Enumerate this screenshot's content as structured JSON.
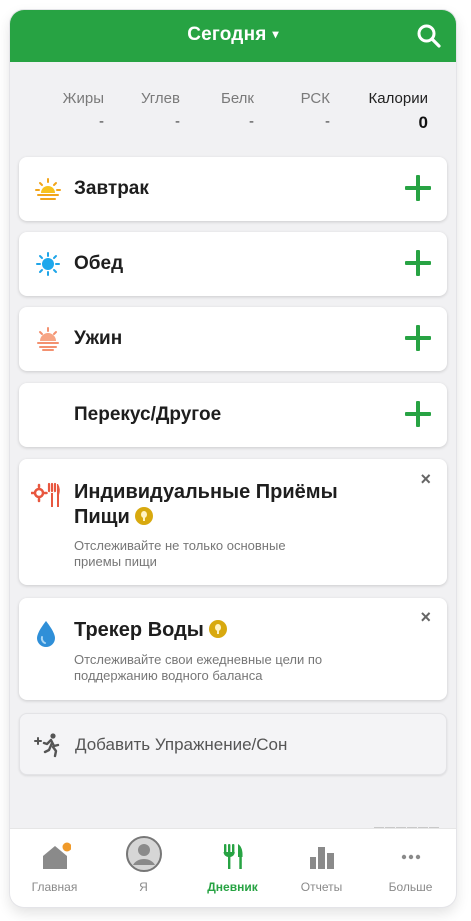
{
  "header": {
    "title": "Сегодня",
    "caret": "▾",
    "accent_color": "#27a343"
  },
  "summary": {
    "fat": {
      "label": "Жиры",
      "value": "-"
    },
    "carbs": {
      "label": "Углев",
      "value": "-"
    },
    "protein": {
      "label": "Белк",
      "value": "-"
    },
    "rsk": {
      "label": "РСК",
      "value": "-"
    },
    "calories": {
      "label": "Калории",
      "value": "0"
    }
  },
  "meals": [
    {
      "label": "Завтрак",
      "icon": "sunrise-icon"
    },
    {
      "label": "Обед",
      "icon": "sun-icon"
    },
    {
      "label": "Ужин",
      "icon": "sunset-icon"
    },
    {
      "label": "Перекус/Другое",
      "icon": "moon-icon"
    }
  ],
  "promos": [
    {
      "title_line1": "Индивидуальные Приёмы",
      "title_line2": "Пищи",
      "description_line1": "Отслеживайте не только основные",
      "description_line2": "приемы пищи",
      "icon": "custom-meals-icon",
      "close": "×"
    },
    {
      "title": "Трекер Воды",
      "description_line1": "Отслеживайте свои ежедневные цели по",
      "description_line2": "поддержанию водного баланса",
      "icon": "water-drop-icon",
      "close": "×"
    }
  ],
  "add_exercise": {
    "label": "Добавить Упражнение/Сон",
    "icon": "exercise-icon"
  },
  "tabs": [
    {
      "label": "Главная",
      "icon": "home-icon",
      "has_badge": true
    },
    {
      "label": "Я",
      "icon": "profile-icon"
    },
    {
      "label": "Дневник",
      "icon": "diary-icon",
      "active": true
    },
    {
      "label": "Отчеты",
      "icon": "reports-icon"
    },
    {
      "label": "Больше",
      "icon": "more-icon"
    }
  ]
}
